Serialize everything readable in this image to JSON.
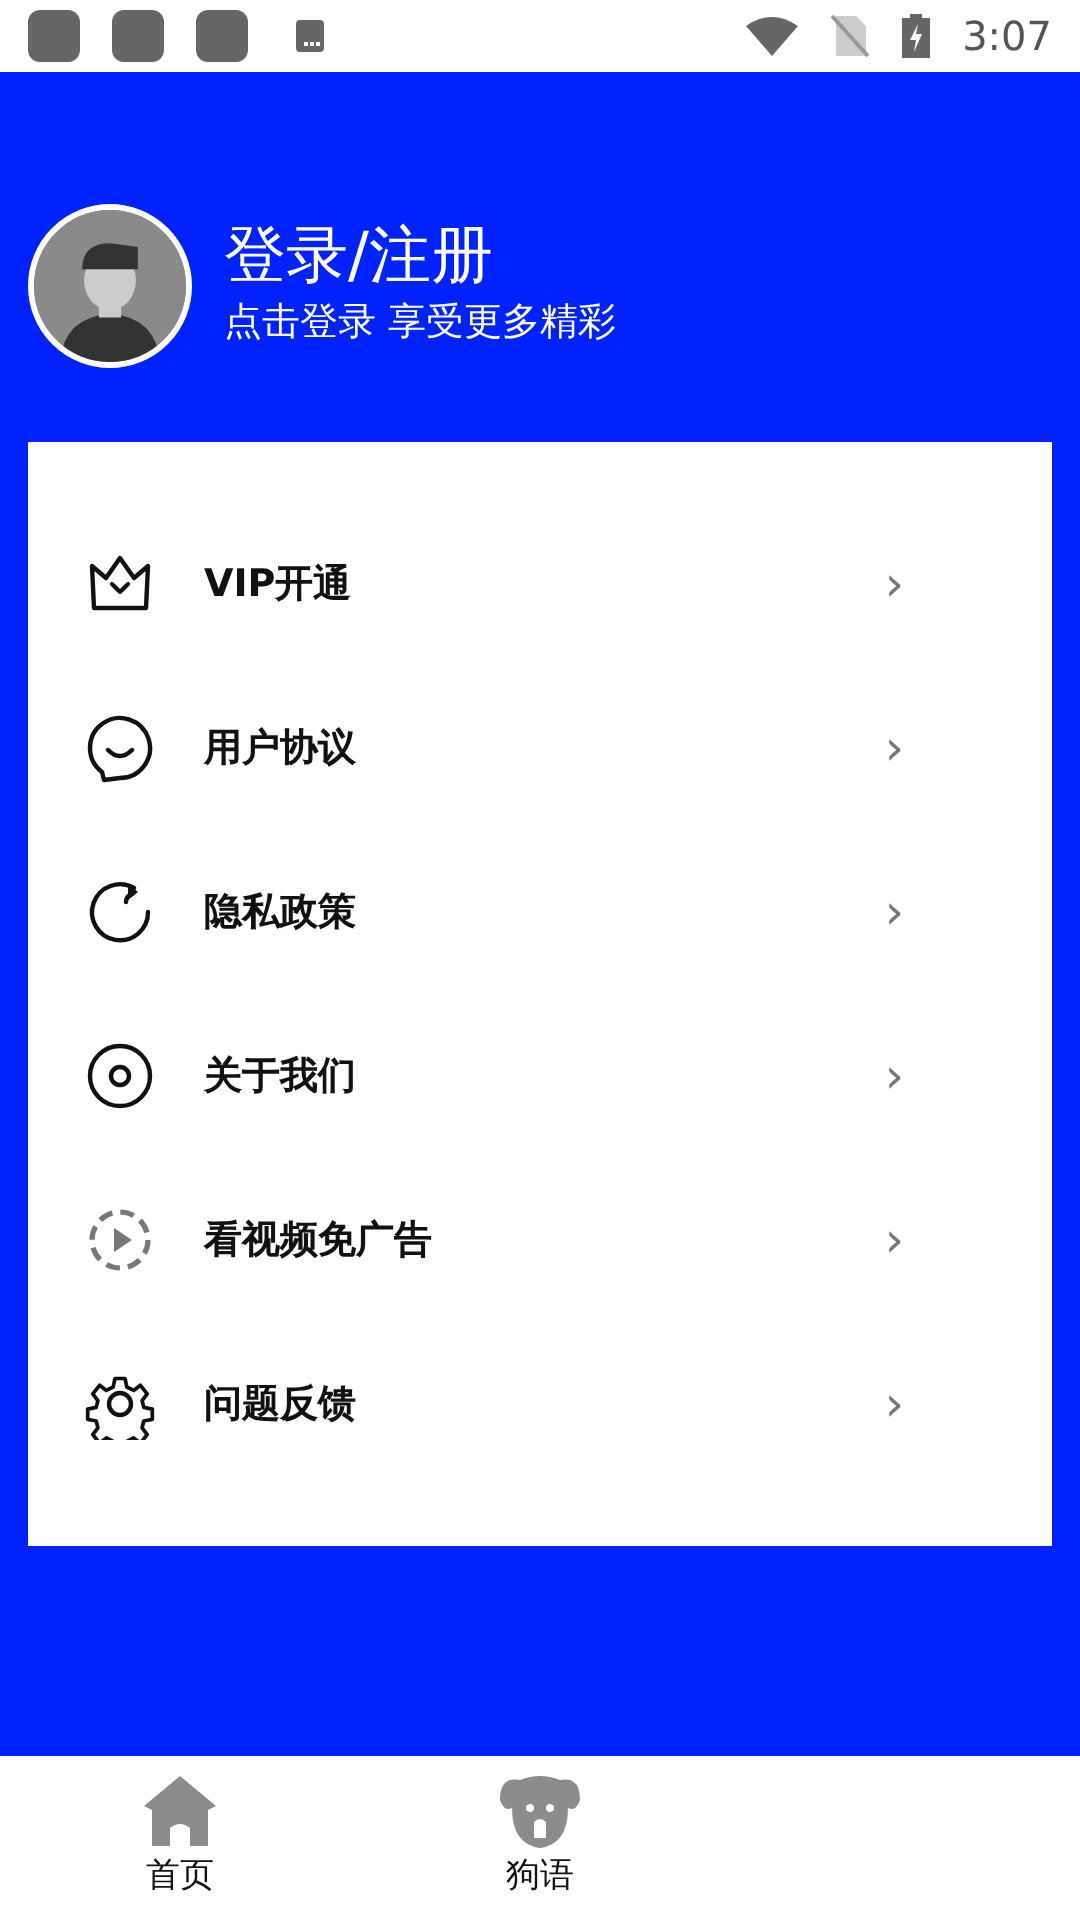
{
  "status_bar": {
    "time": "3:07"
  },
  "profile": {
    "title": "登录/注册",
    "subtitle": "点击登录 享受更多精彩"
  },
  "menu": [
    {
      "kind": "crown",
      "label": "VIP开通",
      "chevron": "›"
    },
    {
      "kind": "chat",
      "label": "用户协议",
      "chevron": "›"
    },
    {
      "kind": "refresh",
      "label": "隐私政策",
      "chevron": "›"
    },
    {
      "kind": "disc",
      "label": "关于我们",
      "chevron": "›"
    },
    {
      "kind": "play",
      "label": "看视频免广告",
      "chevron": "›"
    },
    {
      "kind": "gear",
      "label": "问题反馈",
      "chevron": "›"
    }
  ],
  "bottom_nav": [
    {
      "kind": "home",
      "label": "首页",
      "selected": false
    },
    {
      "kind": "dog",
      "label": "狗语",
      "selected": false
    }
  ]
}
